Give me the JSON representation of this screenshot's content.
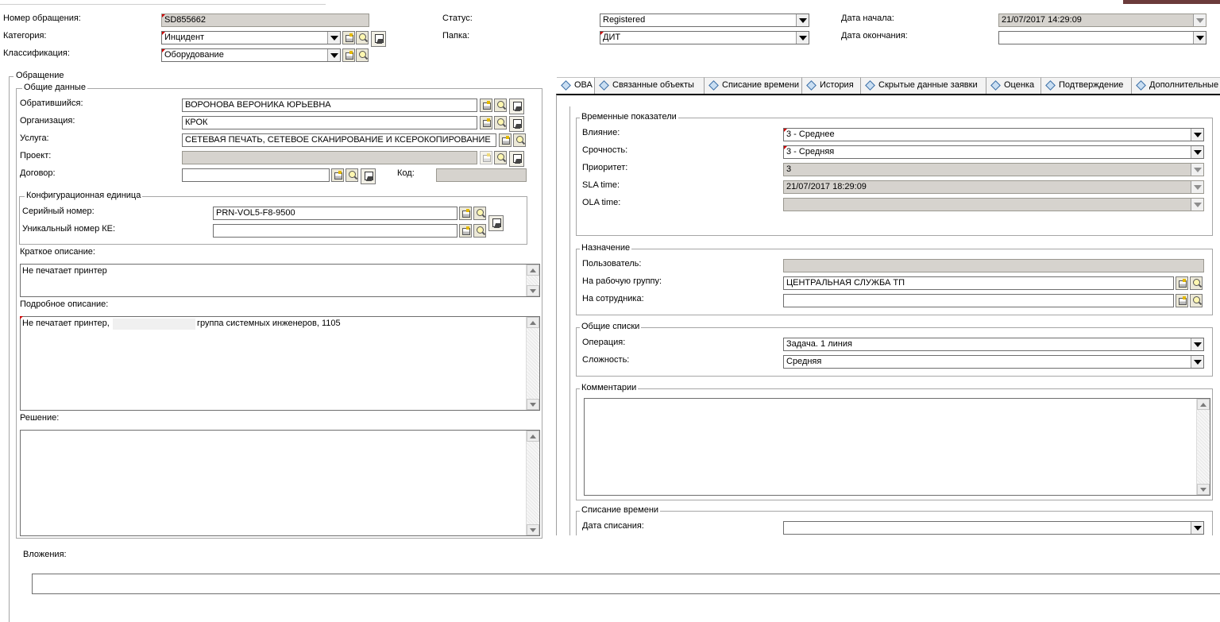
{
  "header": {
    "number_label": "Номер обращения:",
    "number_value": "SD855662",
    "category_label": "Категория:",
    "category_value": "Инцидент",
    "classification_label": "Классификация:",
    "classification_value": "Оборудование",
    "status_label": "Статус:",
    "status_value": "Registered",
    "folder_label": "Папка:",
    "folder_value": "ДИТ",
    "start_label": "Дата начала:",
    "start_value": "21/07/2017 14:29:09",
    "end_label": "Дата окончания:",
    "end_value": ""
  },
  "left": {
    "group_title": "Обращение",
    "general_title": "Общие данные",
    "requester_label": "Обратившийся:",
    "requester_value": "ВОРОНОВА ВЕРОНИКА ЮРЬЕВНА",
    "org_label": "Организация:",
    "org_value": "КРОК",
    "service_label": "Услуга:",
    "service_value": "СЕТЕВАЯ ПЕЧАТЬ, СЕТЕВОЕ СКАНИРОВАНИЕ И КСЕРОКОПИРОВАНИЕ",
    "project_label": "Проект:",
    "project_value": "",
    "contract_label": "Договор:",
    "contract_value": "",
    "code_label": "Код:",
    "code_value": "",
    "ci_title": "Конфигурационная единица",
    "serial_label": "Серийный номер:",
    "serial_value": "PRN-VOL5-F8-9500",
    "unique_label": "Уникальный номер КЕ:",
    "unique_value": "",
    "short_label": "Краткое описание:",
    "short_value": "Не печатает принтер",
    "detail_label": "Подробное описание:",
    "detail_value_a": "Не печатает принтер,",
    "detail_value_b": "группа системных инженеров, 1105",
    "solution_label": "Решение:",
    "solution_value": "",
    "attachments_label": "Вложения:"
  },
  "tabs": [
    {
      "label": "ОВА"
    },
    {
      "label": "Связанные объекты"
    },
    {
      "label": "Списание времени"
    },
    {
      "label": "История"
    },
    {
      "label": "Скрытые данные заявки"
    },
    {
      "label": "Оценка"
    },
    {
      "label": "Подтверждение"
    },
    {
      "label": "Дополнительные"
    }
  ],
  "right": {
    "time_title": "Временные показатели",
    "impact_label": "Влияние:",
    "impact_value": "3 - Среднее",
    "urgency_label": "Срочность:",
    "urgency_value": "3 - Средняя",
    "priority_label": "Приоритет:",
    "priority_value": "3",
    "sla_label": "SLA time:",
    "sla_value": "21/07/2017 18:29:09",
    "ola_label": "OLA time:",
    "ola_value": "",
    "assign_title": "Назначение",
    "user_label": "Пользователь:",
    "user_value": "",
    "workgroup_label": "На рабочую группу:",
    "workgroup_value": "ЦЕНТРАЛЬНАЯ СЛУЖБА ТП",
    "employee_label": "На сотрудника:",
    "employee_value": "",
    "lists_title": "Общие списки",
    "operation_label": "Операция:",
    "operation_value": "Задача. 1 линия",
    "complexity_label": "Сложность:",
    "complexity_value": "Средняя",
    "comments_title": "Комментарии",
    "timewrite_title": "Списание времени",
    "writeoff_label": "Дата списания:",
    "writeoff_value": ""
  }
}
